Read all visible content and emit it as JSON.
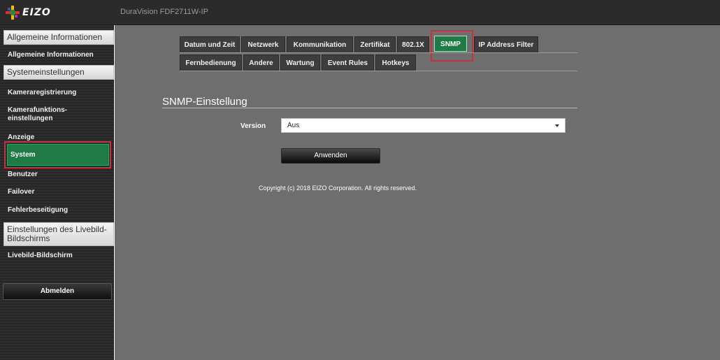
{
  "header": {
    "brand": "EIZO",
    "model": "DuraVision FDF2711W-IP"
  },
  "sidebar": {
    "sections": [
      {
        "title": "Allgemeine Informationen",
        "items": [
          "Allgemeine Informationen"
        ]
      },
      {
        "title": "Systemeinstellungen",
        "items": [
          "Kameraregistrierung",
          "Kamerafunktions-\neinstellungen",
          "Anzeige",
          "System",
          "Benutzer",
          "Failover",
          "Fehlerbeseitigung"
        ]
      },
      {
        "title": "Einstellungen des Livebild-Bildschirms",
        "items": [
          "Livebild-Bildschirm"
        ]
      }
    ],
    "active_item": "System",
    "logout_label": "Abmelden"
  },
  "tabs": {
    "row1": [
      "Datum und Zeit",
      "Netzwerk",
      "Kommunikation",
      "Zertifikat",
      "802.1X",
      "SNMP",
      "IP Address Filter"
    ],
    "row2": [
      "Fernbedienung",
      "Andere",
      "Wartung",
      "Event Rules",
      "Hotkeys"
    ],
    "active": "SNMP"
  },
  "content": {
    "section_title": "SNMP-Einstellung",
    "version_label": "Version",
    "version_value": "Aus",
    "apply_label": "Anwenden",
    "copyright": "Copyright (c) 2018 EIZO Corporation. All rights reserved."
  },
  "colors": {
    "active_green": "#1f7a45",
    "highlight_red": "#c0343f",
    "content_bg": "#6e6e6e"
  }
}
